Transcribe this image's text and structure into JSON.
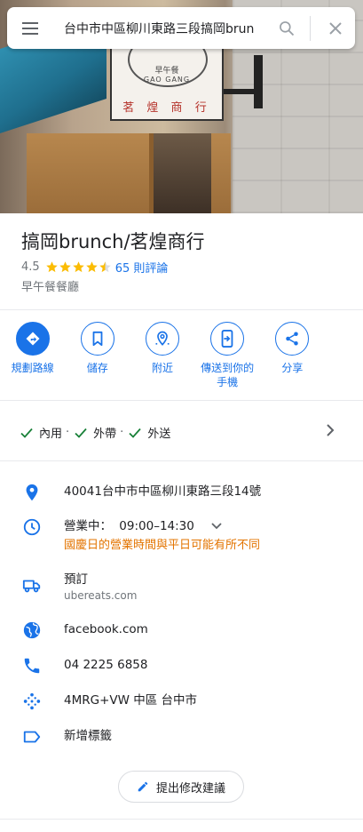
{
  "search": {
    "query": "台中市中區柳川東路三段搞岡brun"
  },
  "hero": {
    "sign_line1": "早午餐",
    "sign_line2": "GAO GANG",
    "sign_line3": "茗 煌 商 行"
  },
  "place": {
    "name": "搞岡brunch/茗煌商行",
    "rating": "4.5",
    "stars": 4.5,
    "reviews": "65 則評論",
    "category": "早午餐餐廳"
  },
  "actions": [
    {
      "label": "規劃路線",
      "icon": "directions-icon"
    },
    {
      "label": "儲存",
      "icon": "bookmark-icon"
    },
    {
      "label": "附近",
      "icon": "nearby-icon"
    },
    {
      "label": "傳送到你的\n手機",
      "label_line1": "傳送到你的",
      "label_line2": "手機",
      "icon": "send-to-phone-icon"
    },
    {
      "label": "分享",
      "icon": "share-icon"
    }
  ],
  "services": {
    "dine_in": "內用",
    "takeout": "外帶",
    "delivery": "外送",
    "separator": "·"
  },
  "info": {
    "address": "40041台中市中區柳川東路三段14號",
    "hours_status": "營業中：",
    "hours": "09:00–14:30",
    "hours_warning": "國慶日的營業時間與平日可能有所不同",
    "order_label": "預訂",
    "order_site": "ubereats.com",
    "website": "facebook.com",
    "phone": "04 2225 6858",
    "plus_code": "4MRG+VW 中區 台中市",
    "add_label": "新增標籤"
  },
  "suggest_edit": "提出修改建議",
  "colors": {
    "accent": "#1a73e8",
    "star": "#fbbc04",
    "warning": "#e37400",
    "text_secondary": "#70757a"
  }
}
